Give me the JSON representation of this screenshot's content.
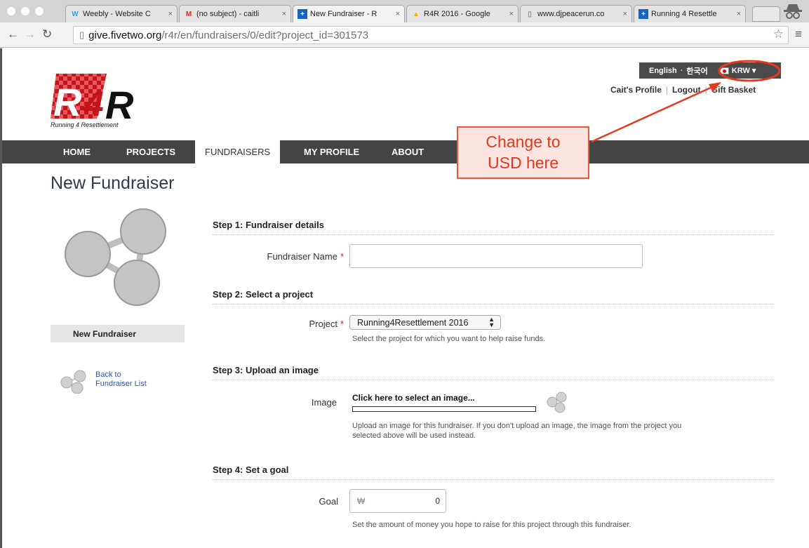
{
  "browser": {
    "tabs": [
      {
        "label": "Weebly - Website C",
        "favicon": "weebly-icon",
        "color": "#2aa2e3"
      },
      {
        "label": "(no subject) - caitli",
        "favicon": "gmail-icon",
        "color": "#d93025"
      },
      {
        "label": "New Fundraiser - R",
        "favicon": "fivetwo-icon",
        "color": "#1565c0"
      },
      {
        "label": "R4R 2016 - Google",
        "favicon": "google-drive-icon",
        "color": "#f4b400"
      },
      {
        "label": "www.djpeacerun.co",
        "favicon": "page-icon",
        "color": "#888888"
      },
      {
        "label": "Running 4 Resettle",
        "favicon": "fivetwo-icon",
        "color": "#1565c0"
      }
    ],
    "url_host": "give.fivetwo.org",
    "url_path": "/r4r/en/fundraisers/0/edit?project_id=301573"
  },
  "header": {
    "lang_english": "English",
    "lang_separator": "·",
    "lang_korean": "한국어",
    "currency": "KRW ▾",
    "profile_link": "Cait's Profile",
    "logout_link": "Logout",
    "basket_link": "Gift Basket",
    "logo_subtitle": "Running 4 Resettlement"
  },
  "nav": {
    "home": "HOME",
    "projects": "PROJECTS",
    "fundraisers": "FUNDRAISERS",
    "my_profile": "MY PROFILE",
    "about": "ABOUT"
  },
  "annotation": {
    "line1": "Change to",
    "line2": "USD here",
    "color": "#e8563c"
  },
  "page": {
    "title": "New Fundraiser",
    "sidebar_label": "New Fundraiser",
    "back_line1": "Back to",
    "back_line2": "Fundraiser List"
  },
  "form": {
    "step1": "Step 1: Fundraiser details",
    "name_label": "Fundraiser Name",
    "required_mark": "*",
    "step2": "Step 2: Select a project",
    "project_label": "Project",
    "project_value": "Running4Resettlement 2016",
    "project_help": "Select the project for which you want to help raise funds.",
    "step3": "Step 3: Upload an image",
    "image_label": "Image",
    "upload_link": "Click here to select an image...",
    "image_help_line1": "Upload an image for this fundraiser. If you don't upload an image, the image from the project you",
    "image_help_line2": "selected above will be used instead.",
    "step4": "Step 4: Set a goal",
    "goal_label": "Goal",
    "goal_currency": "₩",
    "goal_value": "0",
    "goal_help": "Set the amount of money you hope to raise for this project through this fundraiser."
  }
}
